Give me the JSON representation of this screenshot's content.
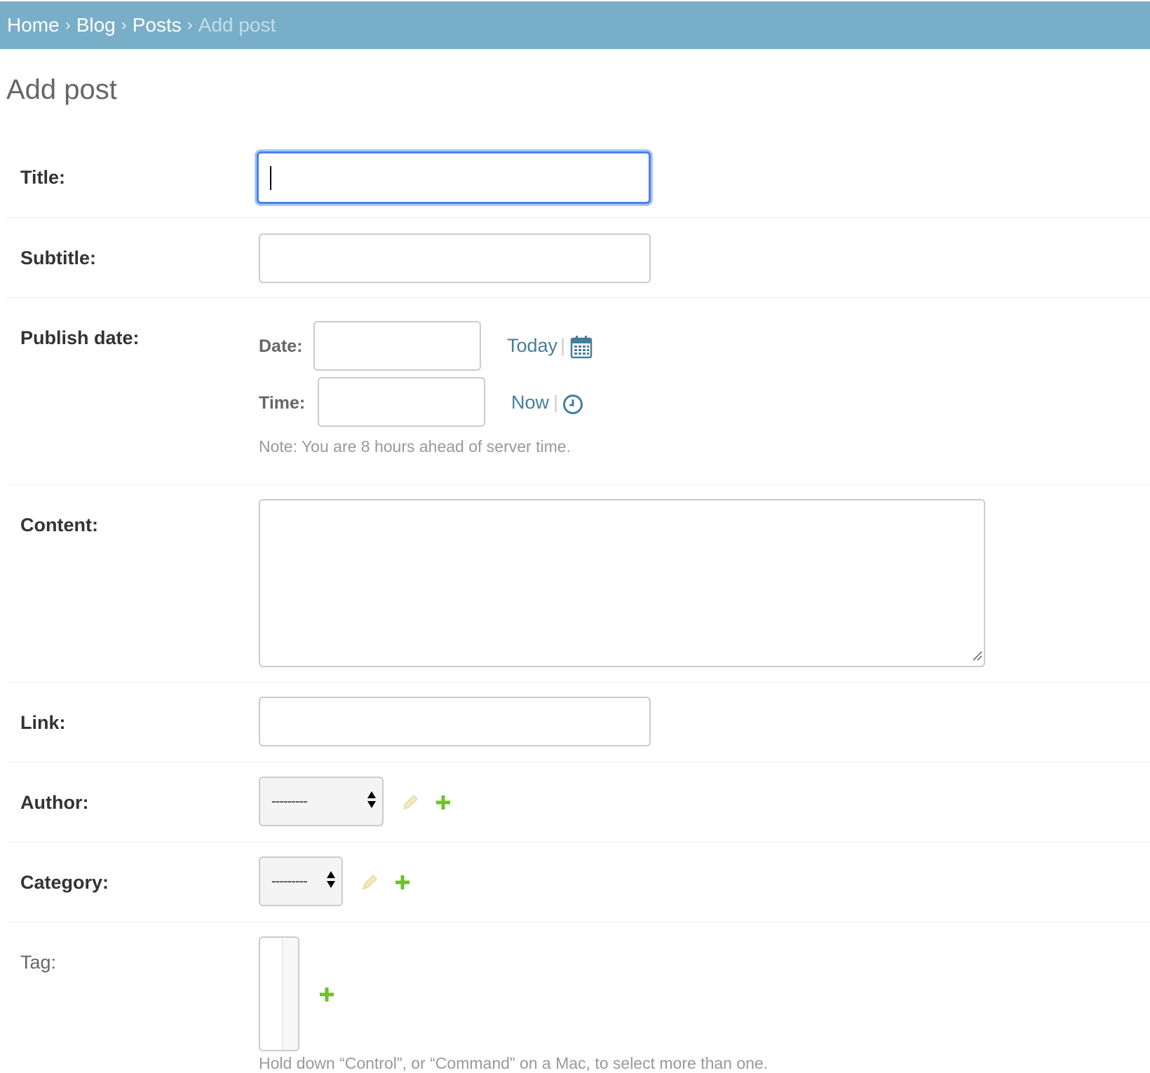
{
  "breadcrumbs": {
    "items": [
      "Home",
      "Blog",
      "Posts"
    ],
    "separator": "›",
    "current": "Add post"
  },
  "page": {
    "title": "Add post"
  },
  "form": {
    "title": {
      "label": "Title:",
      "value": ""
    },
    "subtitle": {
      "label": "Subtitle:",
      "value": ""
    },
    "publish_date": {
      "label": "Publish date:",
      "date_label": "Date:",
      "date_value": "",
      "today_link": "Today",
      "time_label": "Time:",
      "time_value": "",
      "now_link": "Now",
      "separator": "|",
      "note": "Note: You are 8 hours ahead of server time."
    },
    "content": {
      "label": "Content:",
      "value": ""
    },
    "link": {
      "label": "Link:",
      "value": ""
    },
    "author": {
      "label": "Author:",
      "selected": "---------"
    },
    "category": {
      "label": "Category:",
      "selected": "---------"
    },
    "tag": {
      "label": "Tag:",
      "help": "Hold down “Control”, or “Command” on a Mac, to select more than one."
    }
  },
  "colors": {
    "header_bg": "#79aec8",
    "link": "#447e9b",
    "add_icon": "#70bf2b",
    "focus_border": "#4a82e8"
  }
}
